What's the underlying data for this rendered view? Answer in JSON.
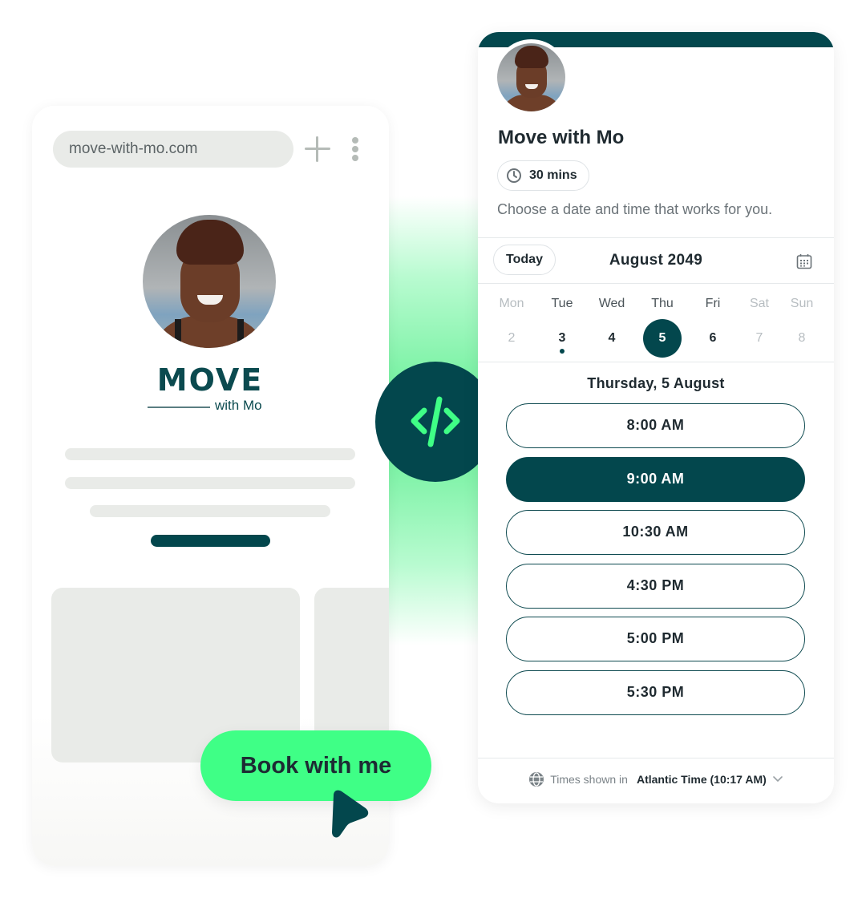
{
  "browser": {
    "url": "move-with-mo.com",
    "new_tab_icon": "plus-icon",
    "menu_icon": "kebab-menu-icon",
    "logo": {
      "word": "MOVE",
      "sub": "with Mo"
    }
  },
  "cta": {
    "label": "Book with me",
    "cursor_icon": "pointer-cursor-icon"
  },
  "embed_icon": "code-icon",
  "scheduler": {
    "title": "Move with Mo",
    "duration": "30 mins",
    "description": "Choose a date and time that works for you.",
    "today_label": "Today",
    "month": "August 2049",
    "days": [
      {
        "name": "Mon",
        "num": "2",
        "state": "unavailable"
      },
      {
        "name": "Tue",
        "num": "3",
        "state": "today"
      },
      {
        "name": "Wed",
        "num": "4",
        "state": "available"
      },
      {
        "name": "Thu",
        "num": "5",
        "state": "selected"
      },
      {
        "name": "Fri",
        "num": "6",
        "state": "available"
      },
      {
        "name": "Sat",
        "num": "7",
        "state": "unavailable"
      },
      {
        "name": "Sun",
        "num": "8",
        "state": "unavailable"
      }
    ],
    "selected_date": "Thursday, 5 August",
    "slots": [
      {
        "time": "8:00 AM",
        "selected": false
      },
      {
        "time": "9:00 AM",
        "selected": true
      },
      {
        "time": "10:30 AM",
        "selected": false
      },
      {
        "time": "4:30 PM",
        "selected": false
      },
      {
        "time": "5:00 PM",
        "selected": false
      },
      {
        "time": "5:30 PM",
        "selected": false
      }
    ],
    "timezone_label": "Times shown in",
    "timezone_value": "Atlantic Time (10:17 AM)"
  },
  "colors": {
    "brand_dark": "#03474d",
    "accent_green": "#3fff86",
    "skeleton": "#e9ebe8"
  }
}
